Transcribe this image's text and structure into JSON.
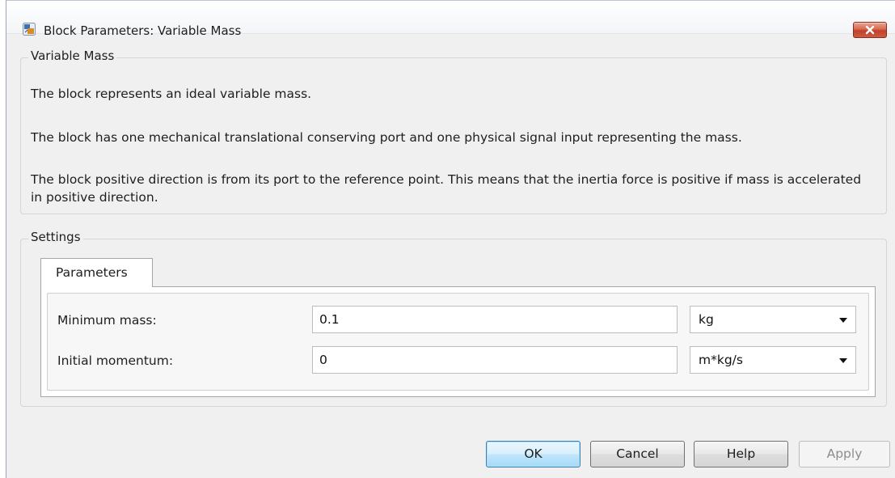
{
  "window": {
    "title": "Block Parameters: Variable Mass",
    "icon": "simulink-block-icon",
    "close_icon": "close-icon"
  },
  "description_group": {
    "title": "Variable Mass",
    "paragraphs": [
      "The block represents an ideal variable mass.",
      "The block has one mechanical translational conserving port and one physical signal input representing the mass.",
      "The block positive direction is from its port to the reference point. This means that the inertia force is positive if mass is accelerated in positive direction."
    ]
  },
  "settings_group": {
    "title": "Settings",
    "tabs": [
      {
        "label": "Parameters",
        "selected": true
      }
    ],
    "parameters": [
      {
        "label": "Minimum mass:",
        "value": "0.1",
        "unit": "kg"
      },
      {
        "label": "Initial momentum:",
        "value": "0",
        "unit": "m*kg/s"
      }
    ]
  },
  "buttons": {
    "ok": "OK",
    "cancel": "Cancel",
    "help": "Help",
    "apply": "Apply"
  },
  "colors": {
    "dialog_background": "#f0f0f0",
    "close_button": "#c0412a",
    "default_button": "#bee6fd",
    "disabled_text": "#8d8d8d"
  }
}
